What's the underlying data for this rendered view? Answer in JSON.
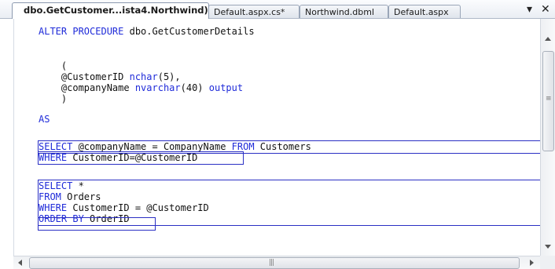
{
  "tabs": [
    {
      "label": "dbo.GetCustomer...ista4.Northwind)",
      "active": true
    },
    {
      "label": "Default.aspx.cs*",
      "active": false
    },
    {
      "label": "Northwind.dbml",
      "active": false
    },
    {
      "label": "Default.aspx",
      "active": false
    }
  ],
  "window_controls": {
    "dropdown": "▾",
    "close": "✕"
  },
  "icons": {
    "scroll_up": "scroll-up-icon",
    "scroll_down": "scroll-down-icon",
    "scroll_left": "scroll-left-icon",
    "scroll_right": "scroll-right-icon"
  },
  "colors": {
    "keyword": "#1f2bd9",
    "text": "#111111",
    "selection_box": "#2a2fc4"
  },
  "code": [
    [
      {
        "t": "ALTER PROCEDURE",
        "k": true
      },
      {
        "t": " dbo.GetCustomerDetails"
      }
    ],
    [],
    [
      {
        "t": "    ("
      }
    ],
    [
      {
        "t": "    @CustomerID "
      },
      {
        "t": "nchar",
        "k": true
      },
      {
        "t": "(5),"
      }
    ],
    [
      {
        "t": "    @companyName "
      },
      {
        "t": "nvarchar",
        "k": true
      },
      {
        "t": "(40) "
      },
      {
        "t": "output",
        "k": true
      }
    ],
    [
      {
        "t": "    )"
      }
    ],
    [],
    [
      {
        "t": "AS",
        "k": true
      }
    ],
    [],
    [
      {
        "t": "SELECT",
        "k": true
      },
      {
        "t": " @companyName = CompanyName "
      },
      {
        "t": "FROM",
        "k": true
      },
      {
        "t": " Customers"
      }
    ],
    [
      {
        "t": "WHERE",
        "k": true
      },
      {
        "t": " CustomerID=@CustomerID"
      }
    ],
    [],
    [
      {
        "t": "SELECT",
        "k": true
      },
      {
        "t": " *"
      }
    ],
    [
      {
        "t": "FROM",
        "k": true
      },
      {
        "t": " Orders"
      }
    ],
    [
      {
        "t": "WHERE",
        "k": true
      },
      {
        "t": " CustomerID = @CustomerID"
      }
    ],
    [
      {
        "t": "ORDER BY",
        "k": true
      },
      {
        "t": " OrderID"
      }
    ]
  ]
}
